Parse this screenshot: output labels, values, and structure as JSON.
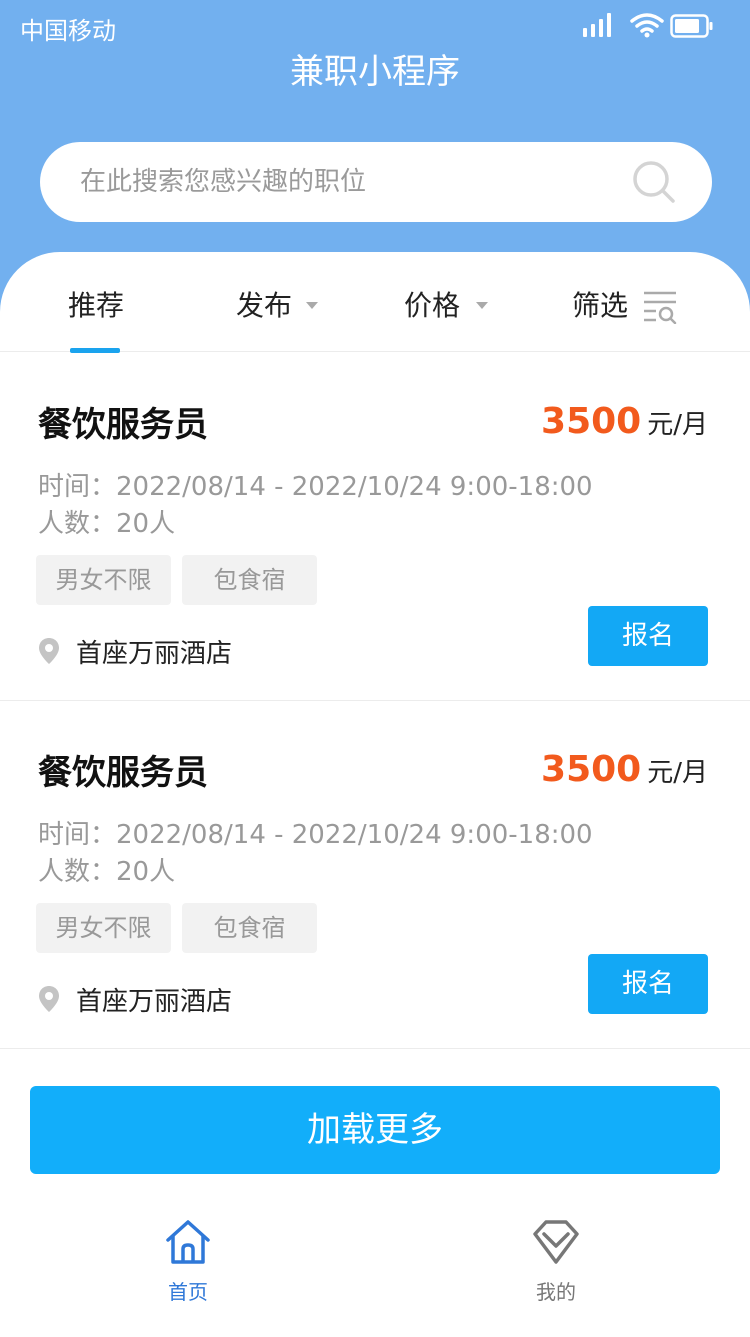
{
  "status_bar": {
    "carrier": "中国移动"
  },
  "header": {
    "title": "兼职小程序"
  },
  "search": {
    "placeholder": "在此搜索您感兴趣的职位"
  },
  "tabs": [
    {
      "label": "推荐",
      "active": true
    },
    {
      "label": "发布"
    },
    {
      "label": "价格"
    },
    {
      "label": "筛选"
    }
  ],
  "jobs": [
    {
      "title": "餐饮服务员",
      "salary_amount": "3500",
      "salary_unit": "元/月",
      "time": "时间：2022/08/14 - 2022/10/24  9:00-18:00",
      "people": "人数：20人",
      "tags": [
        "男女不限",
        "包食宿"
      ],
      "location": "首座万丽酒店",
      "apply_label": "报名"
    },
    {
      "title": "餐饮服务员",
      "salary_amount": "3500",
      "salary_unit": "元/月",
      "time": "时间：2022/08/14 - 2022/10/24  9:00-18:00",
      "people": "人数：20人",
      "tags": [
        "男女不限",
        "包食宿"
      ],
      "location": "首座万丽酒店",
      "apply_label": "报名"
    }
  ],
  "load_more_label": "加载更多",
  "bottom_nav": [
    {
      "label": "首页",
      "icon": "home-icon",
      "active": true
    },
    {
      "label": "我的",
      "icon": "diamond-icon"
    }
  ],
  "colors": {
    "header_bg": "#72b0ef",
    "accent_blue": "#13a8f5",
    "salary_orange": "#f25a1d",
    "nav_active": "#2f78d8"
  }
}
